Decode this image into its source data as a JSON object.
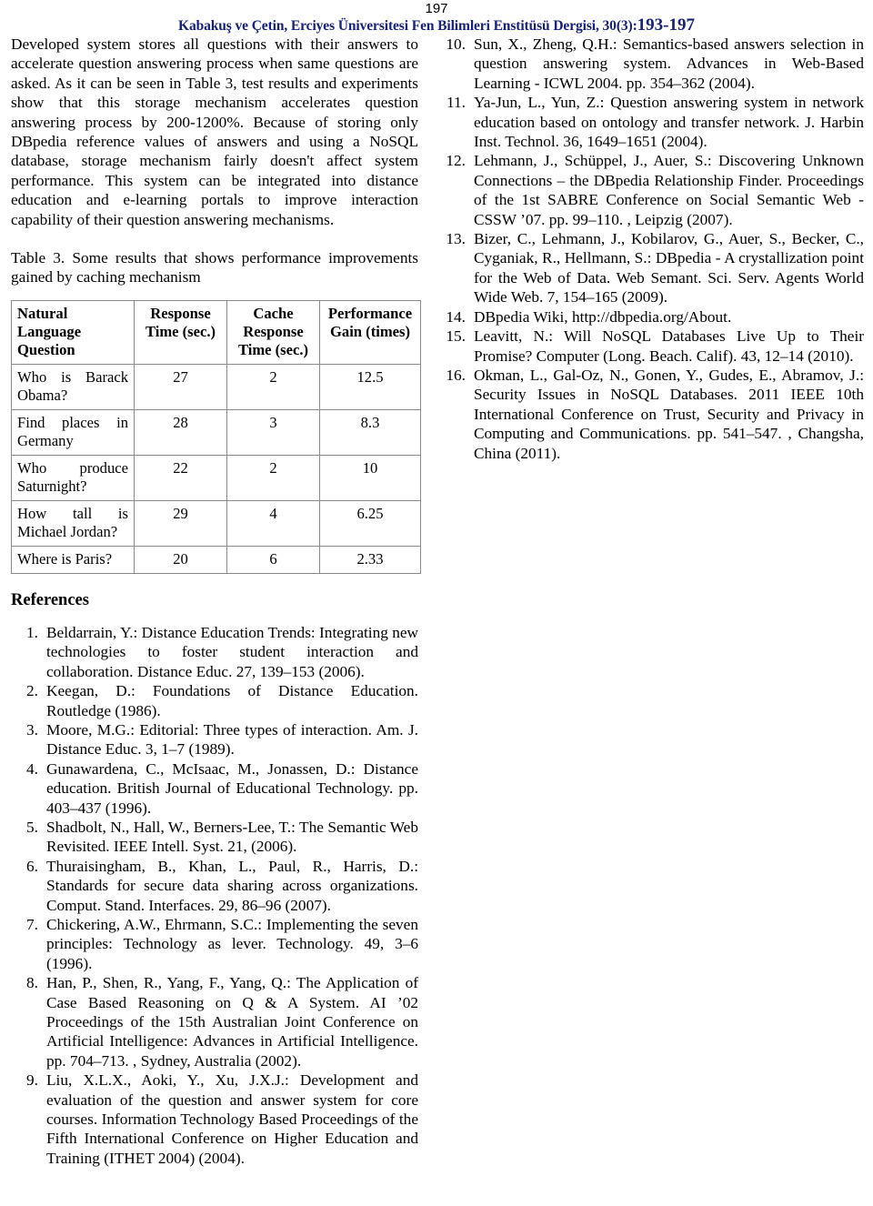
{
  "header": {
    "page_number": "197",
    "journal_line": "Kabakuş ve Çetin,  Erciyes Üniversitesi Fen Bilimleri Enstitüsü Dergisi, 30(3)",
    "journal_separator": ":",
    "journal_pages": "193-197",
    "color": "#16217a"
  },
  "left_column": {
    "paragraph_1": "Developed system stores all questions with their answers to accelerate question answering process when same questions are asked. As it can be seen in Table 3, test results and experiments show that this storage mechanism accelerates question answering process by 200-1200%. Because of storing only DBpedia reference values of answers and using a NoSQL database, storage mechanism fairly doesn't affect system performance. This system can be integrated into distance education and e-learning portals to improve interaction capability of their question answering mechanisms.",
    "table_caption": "Table 3. Some results that shows performance improvements gained by caching mechanism",
    "references_title": "References"
  },
  "table": {
    "headers": [
      "Natural Language Question",
      "Response Time (sec.)",
      "Cache Response Time (sec.)",
      "Performance Gain (times)"
    ],
    "rows": [
      {
        "question": "Who is Barack Obama?",
        "response_time": "27",
        "cache_response_time": "2",
        "performance_gain": "12.5"
      },
      {
        "question": "Find places in Germany",
        "response_time": "28",
        "cache_response_time": "3",
        "performance_gain": "8.3"
      },
      {
        "question": "Who produce Saturnight?",
        "response_time": "22",
        "cache_response_time": "2",
        "performance_gain": "10"
      },
      {
        "question": "How tall is Michael Jordan?",
        "response_time": "29",
        "cache_response_time": "4",
        "performance_gain": "6.25"
      },
      {
        "question": "Where is Paris?",
        "response_time": "20",
        "cache_response_time": "6",
        "performance_gain": "2.33"
      }
    ]
  },
  "references_left": [
    {
      "num": "1.",
      "text": "Beldarrain, Y.: Distance Education Trends: Integrating new technologies to foster student interaction and collaboration. Distance Educ. 27, 139–153 (2006)."
    },
    {
      "num": "2.",
      "text": "Keegan, D.: Foundations of Distance Education. Routledge (1986)."
    },
    {
      "num": "3.",
      "text": "Moore, M.G.: Editorial: Three types of interaction. Am. J. Distance Educ. 3, 1–7 (1989)."
    },
    {
      "num": "4.",
      "text": "Gunawardena, C., McIsaac, M., Jonassen, D.: Distance education. British Journal of Educational Technology. pp. 403–437 (1996)."
    },
    {
      "num": "5.",
      "text": "Shadbolt, N., Hall, W., Berners-Lee, T.: The Semantic Web Revisited. IEEE Intell. Syst. 21, (2006)."
    },
    {
      "num": "6.",
      "text": "Thuraisingham, B., Khan, L., Paul, R., Harris, D.: Standards for secure data sharing across organizations. Comput. Stand. Interfaces. 29, 86–96 (2007)."
    },
    {
      "num": "7.",
      "text": "Chickering, A.W., Ehrmann, S.C.: Implementing the seven principles: Technology as lever. Technology. 49, 3–6 (1996)."
    },
    {
      "num": "8.",
      "text": "Han, P., Shen, R., Yang, F., Yang, Q.: The Application of Case Based Reasoning on Q & A System. AI ’02 Proceedings of the 15th Australian Joint Conference on Artificial Intelligence: Advances in Artificial Intelligence. pp. 704–713. , Sydney, Australia (2002)."
    },
    {
      "num": "9.",
      "text": "Liu, X.L.X., Aoki, Y., Xu, J.X.J.: Development and evaluation of the question and answer system for core courses. Information Technology Based Proceedings of the Fifth International Conference on Higher Education and Training (ITHET 2004) (2004)."
    }
  ],
  "references_right": [
    {
      "num": "10.",
      "text": "Sun, X., Zheng, Q.H.: Semantics-based answers selection in question answering system. Advances in Web-Based Learning - ICWL 2004. pp. 354–362 (2004)."
    },
    {
      "num": "11.",
      "text": "Ya-Jun, L., Yun, Z.: Question answering system in network education based on ontology and transfer network. J. Harbin Inst. Technol. 36, 1649–1651 (2004)."
    },
    {
      "num": "12.",
      "text": "Lehmann, J., Schüppel, J., Auer, S.: Discovering Unknown Connections – the DBpedia Relationship Finder. Proceedings of the 1st SABRE Conference on Social Semantic Web - CSSW ’07. pp. 99–110. , Leipzig (2007)."
    },
    {
      "num": "13.",
      "text": "Bizer, C., Lehmann, J., Kobilarov, G., Auer, S., Becker, C., Cyganiak, R., Hellmann, S.: DBpedia - A crystallization point for the Web of Data. Web Semant. Sci. Serv. Agents World Wide Web. 7, 154–165 (2009)."
    },
    {
      "num": "14.",
      "text": "DBpedia Wiki, http://dbpedia.org/About."
    },
    {
      "num": "15.",
      "text": "Leavitt, N.: Will NoSQL Databases Live Up to Their Promise? Computer (Long. Beach. Calif). 43, 12–14 (2010)."
    },
    {
      "num": "16.",
      "text": "Okman, L., Gal-Oz, N., Gonen, Y., Gudes, E., Abramov, J.: Security Issues in NoSQL Databases. 2011 IEEE 10th International Conference on Trust, Security and Privacy in Computing and Communications. pp. 541–547. , Changsha, China (2011)."
    }
  ]
}
